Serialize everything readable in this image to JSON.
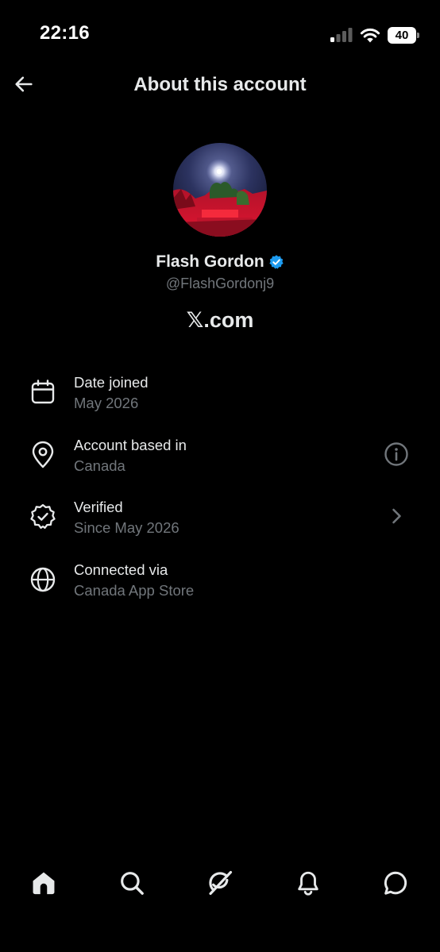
{
  "status_bar": {
    "time": "22:16",
    "battery_level": "40"
  },
  "header": {
    "title": "About this account",
    "back_icon": "arrow-left-icon"
  },
  "profile": {
    "name": "Flash Gordon",
    "handle": "@FlashGordonj9",
    "verified": true,
    "verified_badge_color": "#1d9bf0",
    "platform": "𝕏.com"
  },
  "info_items": [
    {
      "icon": "calendar-icon",
      "title": "Date joined",
      "subtitle": "May 2026",
      "trailing": null
    },
    {
      "icon": "location-pin-icon",
      "title": "Account based in",
      "subtitle": "Canada",
      "trailing": "info-icon"
    },
    {
      "icon": "verified-badge-icon",
      "title": "Verified",
      "subtitle": "Since May 2026",
      "trailing": "chevron-right-icon"
    },
    {
      "icon": "globe-icon",
      "title": "Connected via",
      "subtitle": "Canada App Store",
      "trailing": null
    }
  ],
  "bottom_nav": {
    "items": [
      "home-icon",
      "search-icon",
      "grok-icon",
      "notifications-icon",
      "messages-icon"
    ],
    "active": "home-icon"
  },
  "colors": {
    "background": "#000000",
    "primary_text": "#e7e9ea",
    "secondary_text": "#71767b",
    "accent": "#1d9bf0"
  }
}
